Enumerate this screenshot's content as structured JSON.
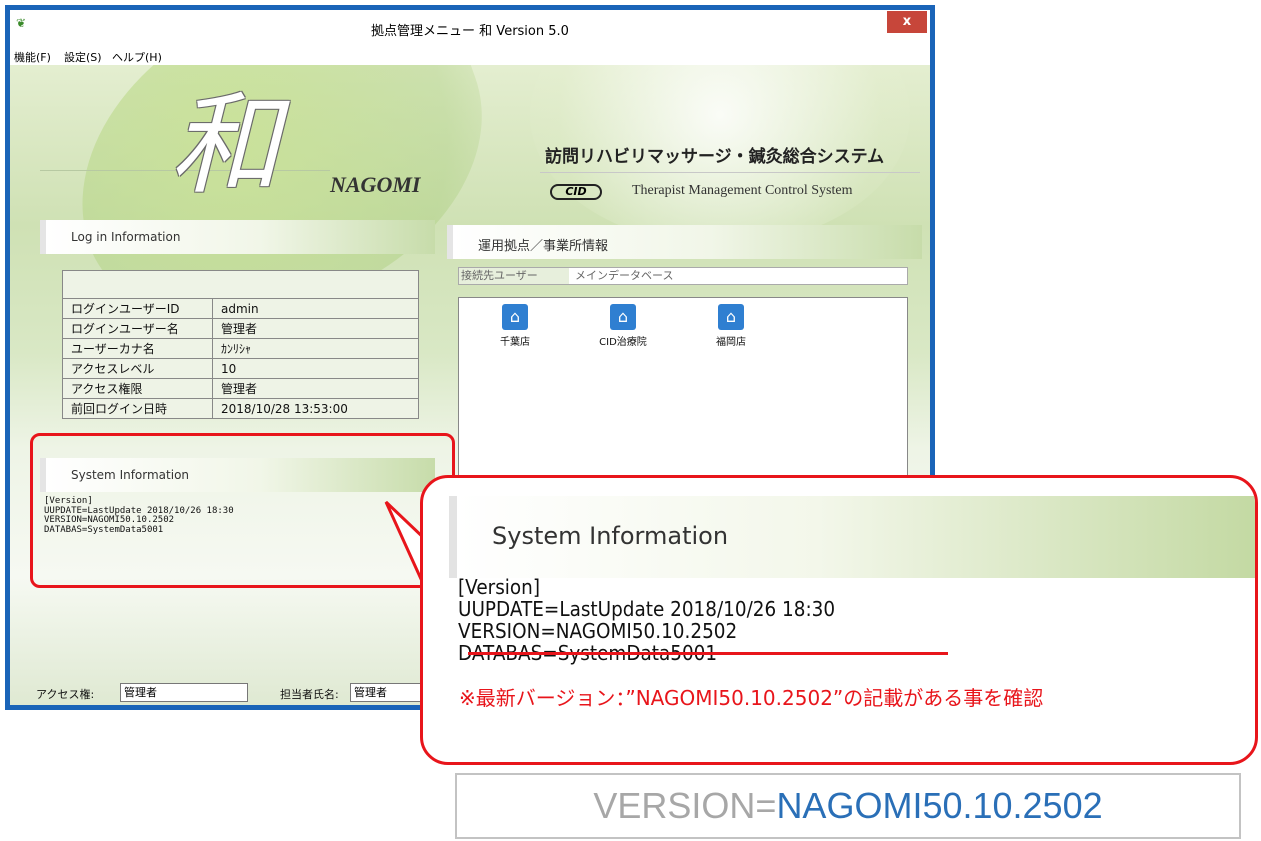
{
  "window": {
    "title": "拠点管理メニュー 和 Version 5.0",
    "close_label": "x",
    "app_icon": "nagomi-leaf-icon"
  },
  "menu": [
    "機能(F)",
    "設定(S)",
    "ヘルプ(H)"
  ],
  "branding": {
    "logo_kanji": "和",
    "logo_roman": "NAGOMI",
    "system_title_ja": "訪問リハビリマッサージ・鍼灸総合システム",
    "company_logo": "CID",
    "system_title_en": "Therapist Management Control System"
  },
  "login_panel": {
    "title": "Log in Information",
    "rows": [
      {
        "key": "ログインユーザーID",
        "value": "admin"
      },
      {
        "key": "ログインユーザー名",
        "value": "管理者"
      },
      {
        "key": "ユーザーカナ名",
        "value": "ｶﾝﾘｼｬ"
      },
      {
        "key": "アクセスレベル",
        "value": "10"
      },
      {
        "key": "アクセス権限",
        "value": "管理者"
      },
      {
        "key": "前回ログイン日時",
        "value": "2018/10/28 13:53:00"
      }
    ]
  },
  "system_panel": {
    "title": "System Information",
    "lines": [
      "[Version]",
      "UUPDATE=LastUpdate 2018/10/26 18:30",
      "VERSION=NAGOMI50.10.2502",
      "DATABAS=SystemData5001"
    ]
  },
  "office_panel": {
    "title": "運用拠点／事業所情報",
    "connection_label": "接続先ユーザー",
    "connection_value": "メインデータベース",
    "stores": [
      "千葉店",
      "CID治療院",
      "福岡店"
    ]
  },
  "status_bar": {
    "access_label": "アクセス権:",
    "access_value": "管理者",
    "staff_label": "担当者氏名:",
    "staff_value": "管理者"
  },
  "zoom_callout": {
    "title": "System Information",
    "lines": [
      "[Version]",
      "UUPDATE=LastUpdate 2018/10/26 18:30",
      "VERSION=NAGOMI50.10.2502",
      "DATABAS=SystemData5001"
    ],
    "note": "※最新バージョン：”NAGOMI50.10.2502”の記載がある事を確認"
  },
  "version_banner": {
    "prefix": "VERSION=",
    "value": "NAGOMI50.10.2502"
  },
  "colors": {
    "window_border": "#1a64b8",
    "annotation_red": "#e8151b",
    "version_blue": "#2a6fb7"
  }
}
